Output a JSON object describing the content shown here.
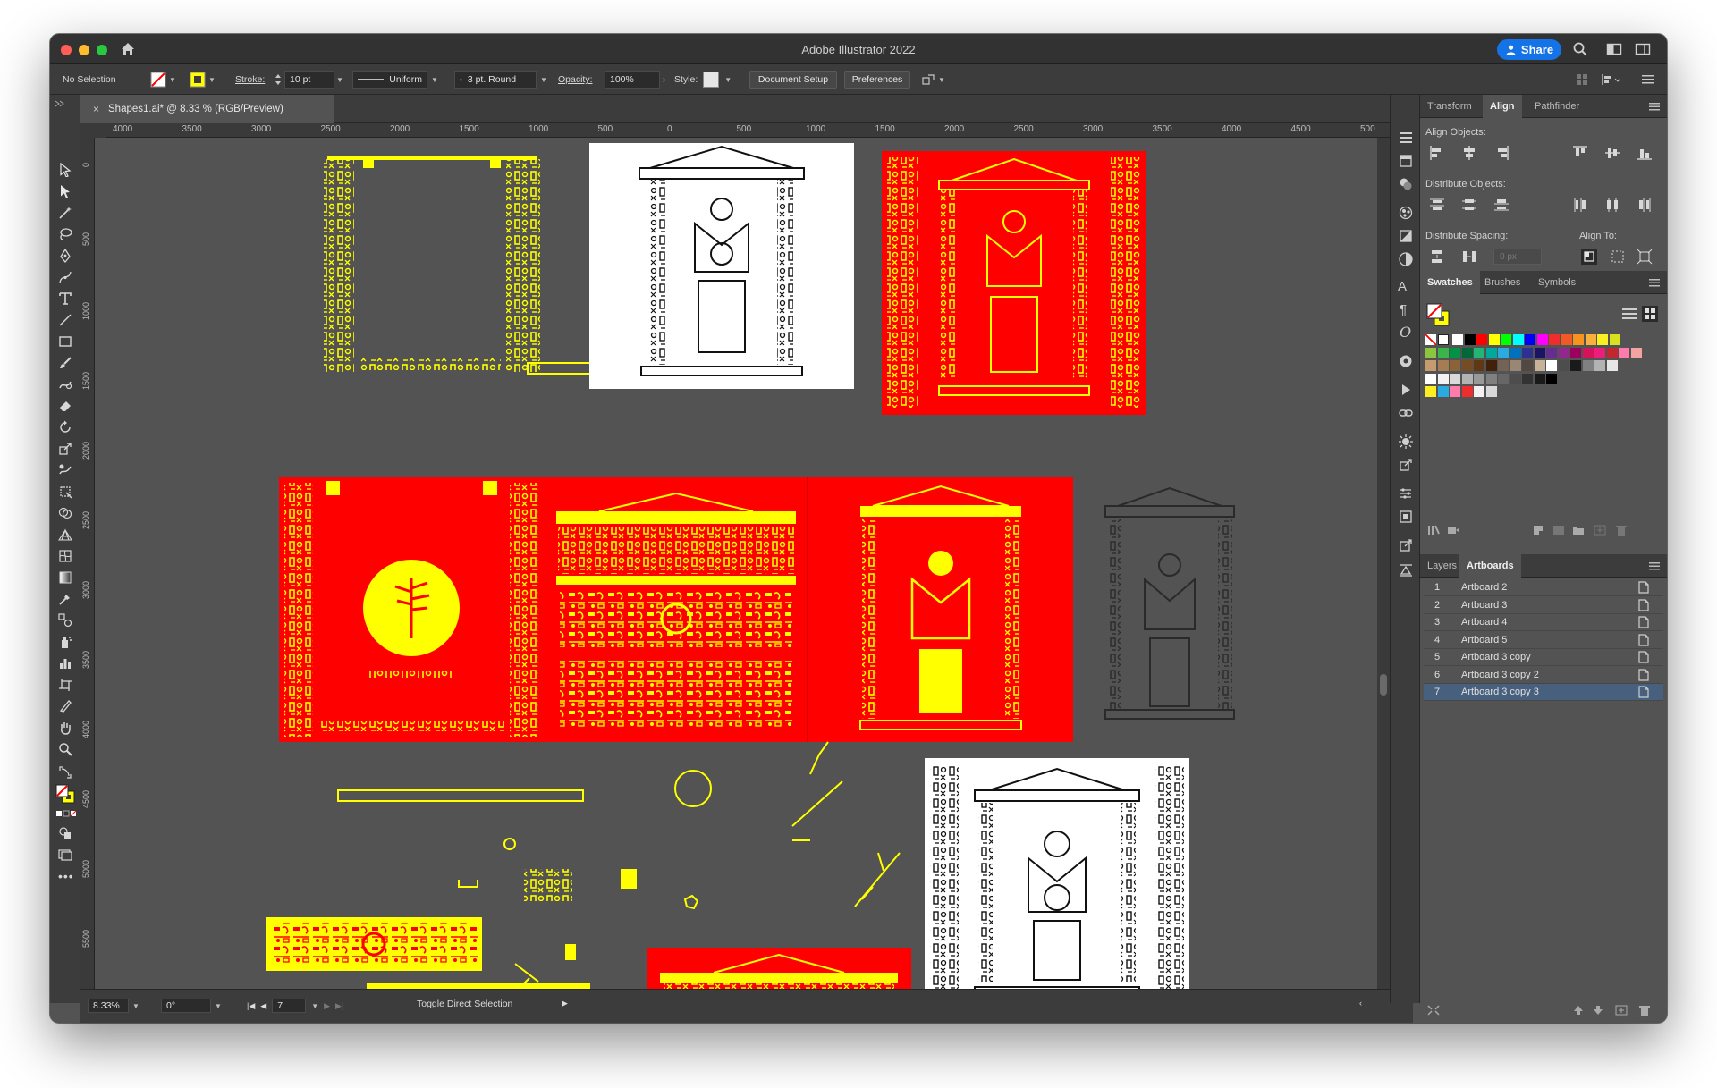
{
  "titlebar": {
    "app_title": "Adobe Illustrator 2022",
    "share_label": "Share",
    "traffic_colors": [
      "#ff5f57",
      "#febc2e",
      "#28c840"
    ]
  },
  "controlbar": {
    "selection": "No Selection",
    "stroke_label": "Stroke:",
    "stroke_value": "10 pt",
    "profile_value": "Uniform",
    "brush_value": "3 pt. Round",
    "opacity_label": "Opacity:",
    "opacity_value": "100%",
    "style_label": "Style:",
    "document_setup": "Document Setup",
    "preferences": "Preferences"
  },
  "document": {
    "tab_title": "Shapes1.ai* @ 8.33 % (RGB/Preview)",
    "close_glyph": "×"
  },
  "rulers": {
    "horizontal": [
      "4000",
      "3500",
      "3000",
      "2500",
      "2000",
      "1500",
      "1000",
      "500",
      "0",
      "500",
      "1000",
      "1500",
      "2000",
      "2500",
      "3000",
      "3500",
      "4000",
      "4500",
      "500"
    ],
    "vertical": [
      "0",
      "500",
      "1000",
      "1500",
      "2000",
      "2500",
      "3000",
      "3500",
      "4000",
      "4500",
      "5000",
      "5500"
    ]
  },
  "statusbar": {
    "zoom": "8.33%",
    "rotation": "0°",
    "artboard_number": "7",
    "tool_hint": "Toggle Direct Selection"
  },
  "panels": {
    "align": {
      "tabs": [
        "Transform",
        "Align",
        "Pathfinder"
      ],
      "active_tab": "Align",
      "align_objects": "Align Objects:",
      "distribute_objects": "Distribute Objects:",
      "distribute_spacing": "Distribute Spacing:",
      "align_to": "Align To:",
      "spacing_value": "0 px"
    },
    "swatches": {
      "tabs": [
        "Swatches",
        "Brushes",
        "Symbols"
      ],
      "active_tab": "Swatches",
      "row1": [
        "#ffffff",
        "#000000",
        "#ff0000",
        "#ffff00",
        "#00ff00",
        "#00ffff",
        "#0000ff",
        "#ff00ff",
        "#ee2d2d",
        "#f15a24",
        "#f7931e",
        "#fbb03b",
        "#fcee21",
        "#d9e021"
      ],
      "row2": [
        "#8cc63f",
        "#39b54a",
        "#009245",
        "#006837",
        "#22b573",
        "#00a99d",
        "#29abe2",
        "#0071bc",
        "#2e3192",
        "#1b1464",
        "#662d91",
        "#93278f",
        "#9e005d",
        "#d4145a",
        "#ed1e79",
        "#c1272d",
        "#ff7bac",
        "#f4a3a3"
      ],
      "row3": [
        "#c69c6d",
        "#a67c52",
        "#8c6239",
        "#754c24",
        "#603813",
        "#42210b",
        "#736357",
        "#998675",
        "#534741",
        "#c7b299",
        "#ffffff",
        "#4d4d4d",
        "#1a1a1a",
        "#808080",
        "#b3b3b3",
        "#e6e6e6"
      ],
      "row4": [
        "#ffffff",
        "#f2f2f2",
        "#d9d9d9",
        "#b3b3b3",
        "#999999",
        "#808080",
        "#666666",
        "#4d4d4d",
        "#333333",
        "#1a1a1a",
        "#000000"
      ],
      "row5": [
        "#fcee21",
        "#29abe2",
        "#ff7bac",
        "#ee2d2d",
        "#f2f2f2",
        "#d9d9d9"
      ]
    },
    "layers": {
      "tabs": [
        "Layers",
        "Artboards"
      ],
      "active_tab": "Artboards",
      "artboards": [
        {
          "num": "1",
          "name": "Artboard 2"
        },
        {
          "num": "2",
          "name": "Artboard 3"
        },
        {
          "num": "3",
          "name": "Artboard 4"
        },
        {
          "num": "4",
          "name": "Artboard 5"
        },
        {
          "num": "5",
          "name": "Artboard 3 copy"
        },
        {
          "num": "6",
          "name": "Artboard 3 copy 2"
        },
        {
          "num": "7",
          "name": "Artboard 3 copy 3"
        }
      ],
      "selected_index": 6
    }
  },
  "colors": {
    "accent": "#1473e6",
    "art_red": "#ff0000",
    "art_yellow": "#ffff00",
    "canvas_gray": "#535353"
  }
}
